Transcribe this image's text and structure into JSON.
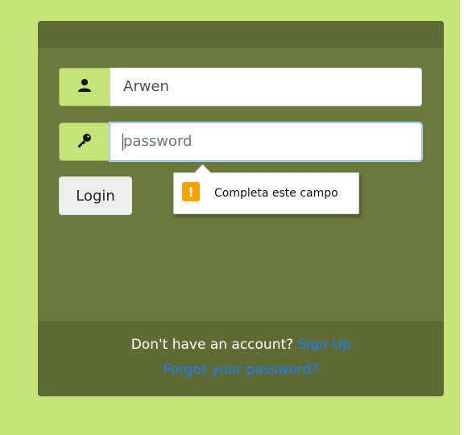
{
  "username": {
    "value": "Arwen",
    "icon": "user-icon"
  },
  "password": {
    "placeholder": "password",
    "icon": "key-icon"
  },
  "login_button": "Login",
  "validation_tooltip": {
    "icon": "warning-icon",
    "symbol": "!",
    "text": "Completa este campo",
    "icon_color": "#f5a300"
  },
  "footer": {
    "prompt": "Don't have an account?",
    "signup_link": "Sign Up",
    "forgot_link": "Forgot your password?"
  },
  "colors": {
    "background": "#c6e377",
    "card": "#6b7a3c",
    "link": "#1a7cff"
  }
}
